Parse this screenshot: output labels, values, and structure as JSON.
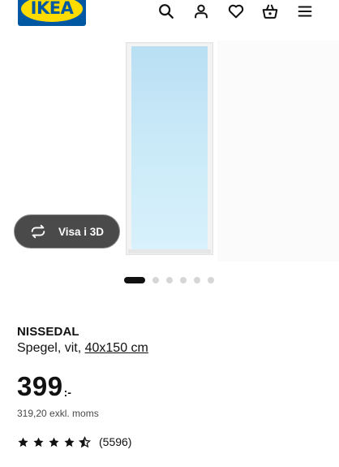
{
  "header": {
    "logo_text": "IKEA",
    "icons": [
      "search-icon",
      "account-icon",
      "heart-icon",
      "basket-icon",
      "menu-icon"
    ]
  },
  "gallery": {
    "view_3d_label": "Visa i 3D",
    "image_count": 6,
    "active_index": 0
  },
  "product": {
    "name": "NISSEDAL",
    "description_prefix": "Spegel, vit, ",
    "size_link": "40x150 cm",
    "price_integer": "399",
    "price_suffix": ":-",
    "price_excl_vat": "319,20 exkl. moms",
    "rating_stars": 4.5,
    "rating_count": "(5596)"
  },
  "colors": {
    "brand_blue": "#0058a3",
    "brand_yellow": "#ffdb00",
    "text": "#111111",
    "view_3d_bg": "#4a4a4a"
  }
}
